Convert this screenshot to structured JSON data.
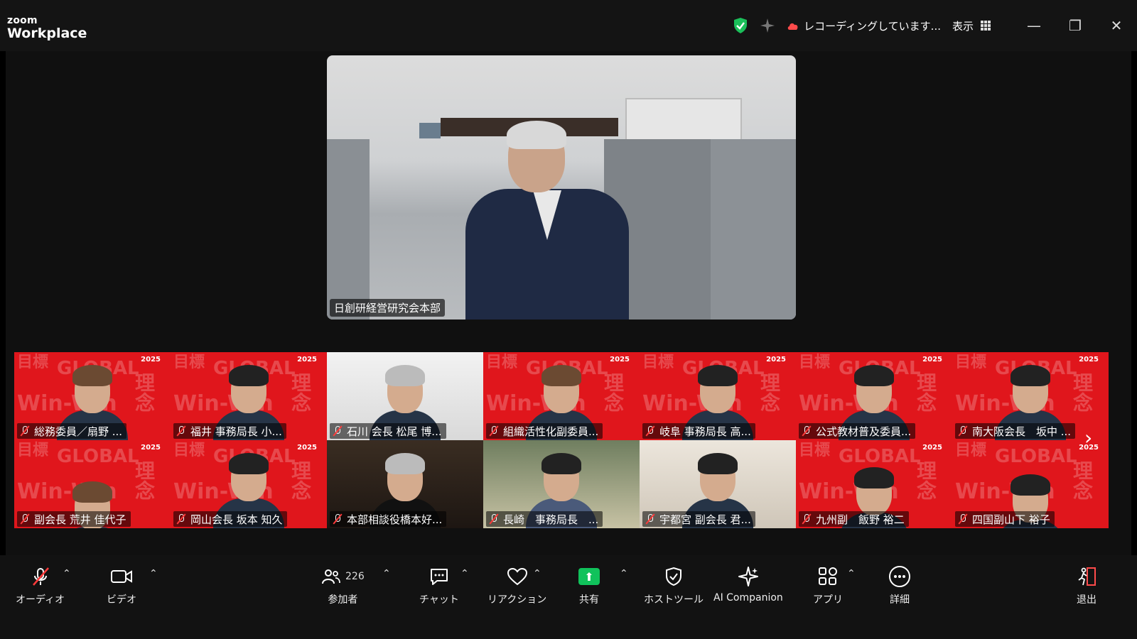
{
  "titlebar": {
    "logo_top": "zoom",
    "logo_bottom": "Workplace",
    "recording": "レコーディングしています...",
    "view": "表示",
    "minimize": "—",
    "restore": "❐",
    "close": "✕"
  },
  "speaker": {
    "name": "日創研経営研究会本部"
  },
  "tiles": [
    {
      "label": "総務委員／扇野 ..."
    },
    {
      "label": "福井 事務局長 小..."
    },
    {
      "label": "石川 会長 松尾 博..."
    },
    {
      "label": "組織活性化副委員..."
    },
    {
      "label": "岐阜 事務局長 高..."
    },
    {
      "label": "公式教材普及委員..."
    },
    {
      "label": "南大阪会長　坂中 ..."
    },
    {
      "label": "副会長 荒井 佳代子"
    },
    {
      "label": "岡山会長 坂本 知久"
    },
    {
      "label": "本部相談役橋本好..."
    },
    {
      "label": "長崎　事務局長　..."
    },
    {
      "label": "宇都宮 副会長 君..."
    },
    {
      "label": "九州副　飯野 裕二"
    },
    {
      "label": "四国副山下 裕子"
    }
  ],
  "background_pattern": {
    "p1": "目標",
    "p2": "GLOBAL",
    "p3": "Win-Win",
    "p4": "理念",
    "year": "2025"
  },
  "toolbar": {
    "audio": "オーディオ",
    "video": "ビデオ",
    "participants": "参加者",
    "participants_count": "226",
    "chat": "チャット",
    "reactions": "リアクション",
    "share": "共有",
    "host_tools": "ホストツール",
    "ai_companion": "AI Companion",
    "apps": "アプリ",
    "more": "詳細",
    "leave": "退出"
  },
  "colors": {
    "tile_red": "#e0161c",
    "share_green": "#10c25b",
    "shield_green": "#1bbf5a",
    "leave_red": "#ff4b4b"
  }
}
